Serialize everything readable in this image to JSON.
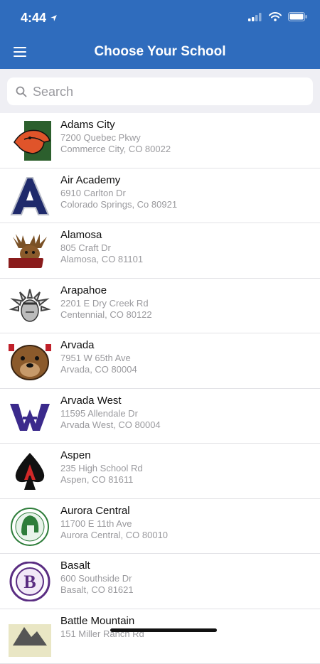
{
  "status_bar": {
    "time": "4:44"
  },
  "header": {
    "title": "Choose Your School"
  },
  "search": {
    "placeholder": "Search"
  },
  "schools": [
    {
      "name": "Adams City",
      "address1": "7200 Quebec Pkwy",
      "address2": "Commerce City, CO 80022",
      "logo": "eagle-logo"
    },
    {
      "name": "Air Academy",
      "address1": "6910 Carlton Dr",
      "address2": "Colorado Springs, Co 80921",
      "logo": "letter-a-logo"
    },
    {
      "name": "Alamosa",
      "address1": "805 Craft Dr",
      "address2": "Alamosa, CO 81101",
      "logo": "moose-logo"
    },
    {
      "name": "Arapahoe",
      "address1": "2201 E Dry Creek Rd",
      "address2": "Centennial, CO 80122",
      "logo": "warrior-headdress-logo"
    },
    {
      "name": "Arvada",
      "address1": "7951 W 65th Ave",
      "address2": "Arvada, CO 80004",
      "logo": "bulldog-logo"
    },
    {
      "name": "Arvada West",
      "address1": "11595 Allendale Dr",
      "address2": "Arvada West, CO 80004",
      "logo": "aw-monogram-logo"
    },
    {
      "name": "Aspen",
      "address1": "235 High School Rd",
      "address2": "Aspen, CO 81611",
      "logo": "spade-a-logo"
    },
    {
      "name": "Aurora Central",
      "address1": "11700 E 11th Ave",
      "address2": "Aurora Central, CO 80010",
      "logo": "spartan-helmet-logo"
    },
    {
      "name": "Basalt",
      "address1": "600 Southside Dr",
      "address2": "Basalt, CO 81621",
      "logo": "b-seal-logo"
    },
    {
      "name": "Battle Mountain",
      "address1": "151 Miller Ranch Rd",
      "address2": "",
      "logo": "mountain-logo"
    }
  ],
  "colors": {
    "header": "#2f6cbd",
    "background": "#efeff4"
  }
}
